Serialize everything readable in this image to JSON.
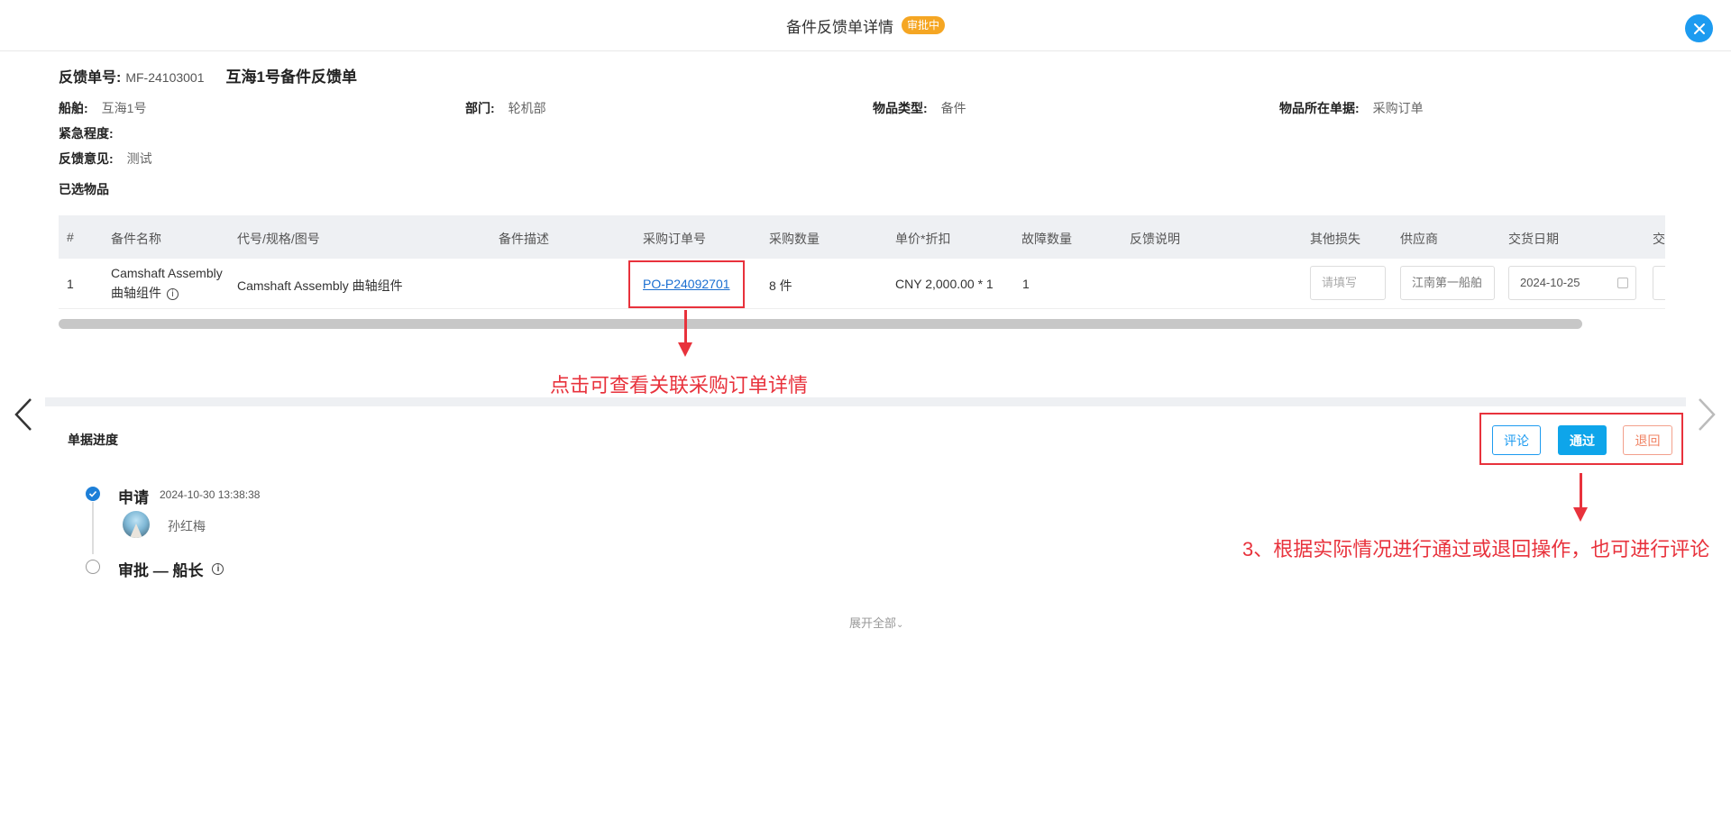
{
  "header": {
    "title": "备件反馈单详情",
    "status_badge": "审批中"
  },
  "doc": {
    "number_label": "反馈单号:",
    "number": "MF-24103001",
    "name": "互海1号备件反馈单"
  },
  "fields": {
    "ship_label": "船舶:",
    "ship": "互海1号",
    "dept_label": "部门:",
    "dept": "轮机部",
    "item_type_label": "物品类型:",
    "item_type": "备件",
    "source_doc_label": "物品所在单据:",
    "source_doc": "采购订单",
    "urgency_label": "紧急程度:",
    "urgency": "",
    "feedback_label": "反馈意见:",
    "feedback": "测试"
  },
  "selected_items_label": "已选物品",
  "table": {
    "headers": [
      "#",
      "备件名称",
      "代号/规格/图号",
      "备件描述",
      "采购订单号",
      "采购数量",
      "单价*折扣",
      "故障数量",
      "反馈说明",
      "其他损失",
      "供应商",
      "交货日期",
      "交"
    ],
    "row": {
      "index": "1",
      "name_line1": "Camshaft Assembly",
      "name_line2": "曲轴组件",
      "code": "Camshaft Assembly 曲轴组件",
      "description": "",
      "po_number": "PO-P24092701",
      "qty": "8 件",
      "price": "CNY  2,000.00 * 1",
      "fault_qty": "1",
      "feedback_note": "",
      "other_loss_placeholder": "请填写",
      "supplier": "江南第一船舶",
      "delivery_date": "2024-10-25"
    }
  },
  "annotations": {
    "po_hint": "点击可查看关联采购订单详情",
    "action_hint": "3、根据实际情况进行通过或退回操作，也可进行评论"
  },
  "progress": {
    "title": "单据进度",
    "buttons": {
      "comment": "评论",
      "approve": "通过",
      "return": "退回"
    },
    "steps": [
      {
        "title": "申请",
        "time": "2024-10-30 13:38:38",
        "person": "孙红梅",
        "done": true
      },
      {
        "title": "审批 — 船长",
        "done": false
      }
    ],
    "expand_all": "展开全部"
  },
  "colors": {
    "accent": "#1d9bf0",
    "badge": "#f5a623",
    "annotation": "#e8323c",
    "return": "#f08465"
  }
}
